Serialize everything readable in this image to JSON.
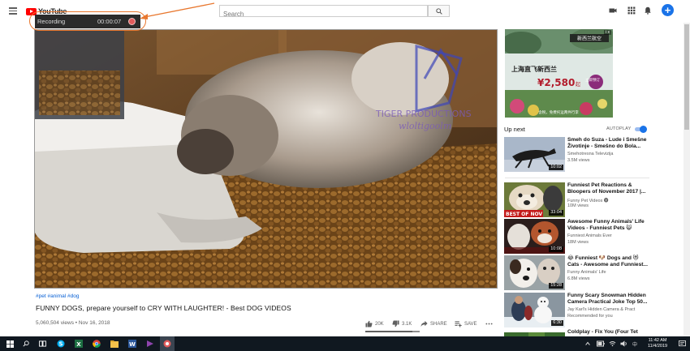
{
  "app": {
    "logo_text": "YouTube"
  },
  "search": {
    "placeholder": "Search"
  },
  "recording": {
    "label": "Recording",
    "time": "00:00:07"
  },
  "video": {
    "watermark_line1": "TIGER PRODUCTIONS",
    "watermark_line2": "wloltigoolm",
    "tags": "#pet #animal #dog",
    "title": "FUNNY DOGS, prepare yourself to CRY WITH LAUGHTER! - Best DOG VIDEOS",
    "views_date": "5,060,504 views • Nov 16, 2018",
    "likes": "20K",
    "dislikes": "3.1K",
    "share_label": "SHARE",
    "save_label": "SAVE",
    "like_ratio": 0.87
  },
  "ad": {
    "badge": "i x",
    "headline_cn": "上海直飞新西兰",
    "price": "¥2,580",
    "price_suffix": "起",
    "cta": "立即预订",
    "tag": "新西兰航空",
    "footnote": "含税，免费托运两件行李"
  },
  "sidebar": {
    "upnext_label": "Up next",
    "autoplay_label": "AUTOPLAY",
    "autoplay_on": true,
    "items": [
      {
        "title": "Smeh do Suza - Lude i Smešne Životinje - Smešno do Bola...",
        "channel": "Smehotresna Televizija",
        "views": "3.5M views",
        "duration": "10:02"
      },
      {
        "title": "Funniest Pet Reactions & Bloopers of November 2017 |...",
        "channel": "Funny Pet Videos 🅥",
        "views": "10M views",
        "duration": "33:04",
        "overlay": "BEST OF NOV"
      },
      {
        "title": "Awesome Funny Animals' Life Videos - Funniest Pets 😺",
        "channel": "Funniest Animals Ever",
        "views": "18M views",
        "duration": "10:08"
      },
      {
        "title": "😂 Funniest 🐶 Dogs and 😻 Cats - Awesome and Funniest...",
        "channel": "Funny Animals' Life",
        "views": "6.8M views",
        "duration": "15:28"
      },
      {
        "title": "Funny Scary Snowman Hidden Camera Practical Joke Top 50...",
        "channel": "Jay Karl's Hidden Camera & Pract",
        "views": "Recommended for you",
        "duration": "6:30"
      },
      {
        "title": "Coldplay - Fix You (Four Tet",
        "channel": "",
        "views": "",
        "duration": ""
      }
    ]
  },
  "taskbar": {
    "time": "11:42 AM",
    "date": "11/4/2019",
    "lang": "中"
  },
  "colors": {
    "accent_blue": "#065fd4",
    "recording_ring": "#e8772e",
    "brand_red": "#ff0000",
    "avatar_blue": "#1a73e8"
  }
}
